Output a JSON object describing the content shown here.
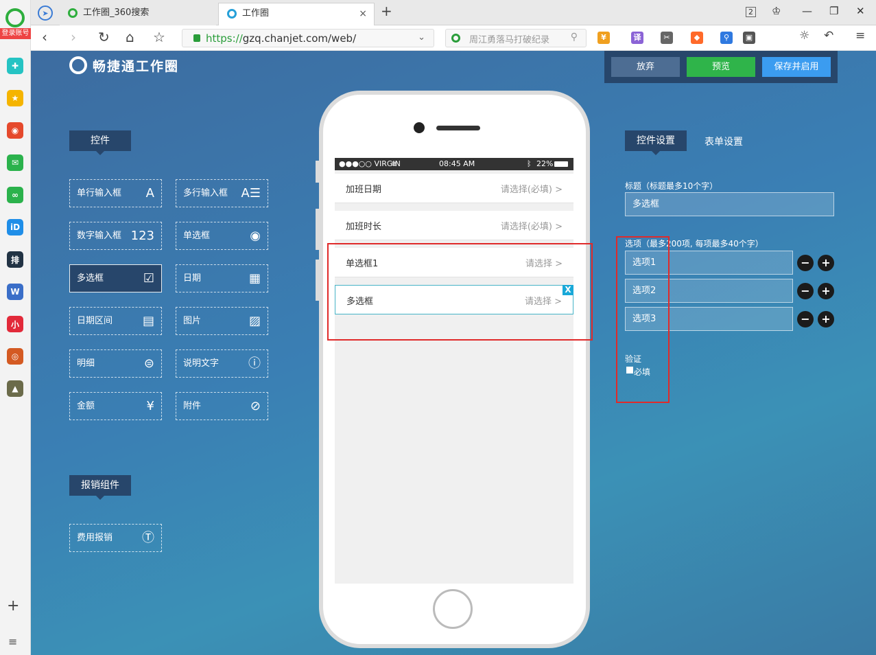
{
  "browser": {
    "login_badge": "登录账号",
    "tabs": [
      {
        "label": "工作圈_360搜索",
        "active": false
      },
      {
        "label": "工作圈",
        "active": true
      }
    ],
    "tab_close": "×",
    "new_tab": "+",
    "tab_count": "2",
    "url": "https://gzq.chanjet.com/web/",
    "url_protocol": "https://",
    "url_rest": "gzq.chanjet.com/web/",
    "search_placeholder": "周江勇落马打破纪录",
    "side_plus": "+",
    "side_menu": "≡",
    "extensions": [
      {
        "label": "¥",
        "color": "#f0a020"
      },
      {
        "label": "译",
        "color": "#8b63d6"
      },
      {
        "label": "✂",
        "color": "#666666"
      },
      {
        "label": "◆",
        "color": "#ff6a2a"
      },
      {
        "label": "⚲",
        "color": "#2f79e0"
      },
      {
        "label": "▣",
        "color": "#555555"
      }
    ],
    "sidebar_apps": [
      {
        "label": "✚",
        "color": "#25c3c3"
      },
      {
        "label": "★",
        "color": "#f5b400"
      },
      {
        "label": "◉",
        "color": "#e5492c"
      },
      {
        "label": "✉",
        "color": "#2bb24c"
      },
      {
        "label": "∞",
        "color": "#2bb24c"
      },
      {
        "label": "iD",
        "color": "#1f8ee8"
      },
      {
        "label": "排",
        "color": "#223344"
      },
      {
        "label": "W",
        "color": "#3a6ec8"
      },
      {
        "label": "小",
        "color": "#e22a3a"
      },
      {
        "label": "◎",
        "color": "#d45a22"
      },
      {
        "label": "▲",
        "color": "#6b6b4a"
      }
    ]
  },
  "app": {
    "brand": "畅捷通工作圈",
    "actions": {
      "discard": "放弃",
      "preview": "预览",
      "save": "保存并启用"
    },
    "controls_title": "控件",
    "controls": [
      {
        "label": "单行输入框",
        "icon": "A",
        "icon_name": "text-icon"
      },
      {
        "label": "多行输入框",
        "icon": "A☰",
        "icon_name": "multiline-text-icon"
      },
      {
        "label": "数字输入框",
        "icon": "123",
        "icon_name": "number-icon"
      },
      {
        "label": "单选框",
        "icon": "◉",
        "icon_name": "radio-icon"
      },
      {
        "label": "多选框",
        "icon": "☑",
        "icon_name": "checkbox-icon",
        "selected": true
      },
      {
        "label": "日期",
        "icon": "▦",
        "icon_name": "calendar-icon"
      },
      {
        "label": "日期区间",
        "icon": "▤",
        "icon_name": "date-range-icon"
      },
      {
        "label": "图片",
        "icon": "▨",
        "icon_name": "image-icon"
      },
      {
        "label": "明细",
        "icon": "⊜",
        "icon_name": "list-icon"
      },
      {
        "label": "说明文字",
        "icon": "ⓘ",
        "icon_name": "info-icon"
      },
      {
        "label": "金额",
        "icon": "¥",
        "icon_name": "yen-icon"
      },
      {
        "label": "附件",
        "icon": "⊘",
        "icon_name": "attachment-icon"
      }
    ],
    "expense_title": "报销组件",
    "expense_controls": [
      {
        "label": "费用报销",
        "icon": "Ⓣ",
        "icon_name": "expense-icon"
      }
    ],
    "phone": {
      "status": {
        "carrier": "●●●○○ VIRGIN",
        "time": "08:45 AM",
        "battery": "22%"
      },
      "rows": [
        {
          "label": "加班日期",
          "value": "请选择(必填) >"
        },
        {
          "label": "加班时长",
          "value": "请选择(必填) >"
        },
        {
          "label": "单选框1",
          "value": "请选择 >"
        },
        {
          "label": "多选框",
          "value": "请选择 >",
          "selected": true
        }
      ],
      "close": "X"
    },
    "settings": {
      "tab_active": "控件设置",
      "tab_other": "表单设置",
      "title_label": "标题（标题最多10个字）",
      "title_value": "多选框",
      "options_label": "选项（最多200项, 每项最多40个字）",
      "options": [
        "选项1",
        "选项2",
        "选项3"
      ],
      "minus": "−",
      "plus": "+",
      "validation_label": "验证",
      "required_label": "必填"
    },
    "colors": {
      "discard": "#4d6d93",
      "preview": "#2fb44a",
      "save": "#3b9cf0",
      "highlight": "#e02a2a"
    }
  }
}
